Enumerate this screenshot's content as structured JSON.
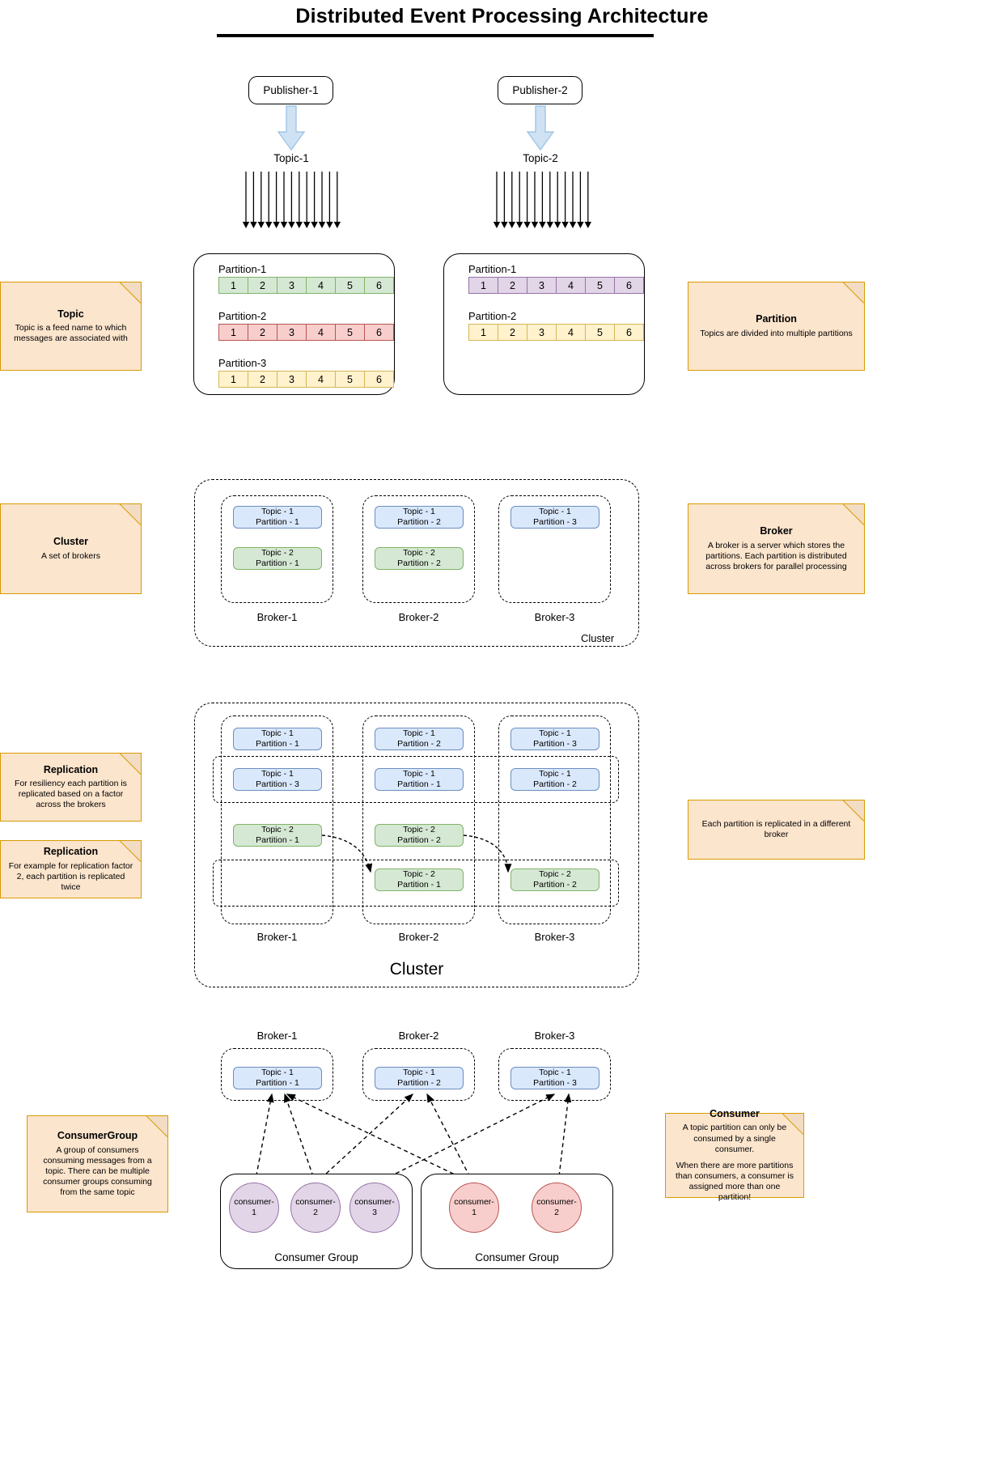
{
  "title": "Distributed Event Processing Architecture",
  "publishers": [
    {
      "label": "Publisher-1",
      "topic_label": "Topic-1"
    },
    {
      "label": "Publisher-2",
      "topic_label": "Topic-2"
    }
  ],
  "topics": [
    {
      "name": "Topic-1",
      "partitions": [
        {
          "label": "Partition-1",
          "color": "green",
          "cells": [
            "1",
            "2",
            "3",
            "4",
            "5",
            "6"
          ]
        },
        {
          "label": "Partition-2",
          "color": "red",
          "cells": [
            "1",
            "2",
            "3",
            "4",
            "5",
            "6"
          ]
        },
        {
          "label": "Partition-3",
          "color": "yellow",
          "cells": [
            "1",
            "2",
            "3",
            "4",
            "5",
            "6"
          ]
        }
      ]
    },
    {
      "name": "Topic-2",
      "partitions": [
        {
          "label": "Partition-1",
          "color": "purple",
          "cells": [
            "1",
            "2",
            "3",
            "4",
            "5",
            "6"
          ]
        },
        {
          "label": "Partition-2",
          "color": "yellow",
          "cells": [
            "1",
            "2",
            "3",
            "4",
            "5",
            "6"
          ]
        }
      ]
    }
  ],
  "notes": {
    "topic": {
      "title": "Topic",
      "body": "Topic is a feed name to which messages are associated with"
    },
    "partition": {
      "title": "Partition",
      "body": "Topics are divided into multiple partitions"
    },
    "cluster": {
      "title": "Cluster",
      "body": "A set of brokers"
    },
    "broker": {
      "title": "Broker",
      "body": "A broker is a server which stores the partitions. Each partition is distributed across brokers for parallel processing"
    },
    "replication1": {
      "title": "Replication",
      "body": "For resiliency each partition is replicated based on a factor across the brokers"
    },
    "replication2": {
      "title": "Replication",
      "body": "For example for replication factor 2, each partition is replicated twice"
    },
    "replication3": {
      "title": "",
      "body": "Each partition is replicated in a different broker"
    },
    "consumergroup": {
      "title": "ConsumerGroup",
      "body": "A group of consumers consuming messages from a topic. There can be multiple consumer groups consuming from the same topic"
    },
    "consumer": {
      "title": "Consumer",
      "body": "A topic partition can only be consumed by a single consumer.",
      "body2": "When there are more partitions than consumers, a consumer is assigned more than one partition!"
    }
  },
  "cluster_section": {
    "cluster_label": "Cluster",
    "brokers": [
      {
        "label": "Broker-1",
        "partitions": [
          {
            "line1": "Topic - 1",
            "line2": "Partition - 1",
            "color": "blue"
          },
          {
            "line1": "Topic - 2",
            "line2": "Partition - 1",
            "color": "green"
          }
        ]
      },
      {
        "label": "Broker-2",
        "partitions": [
          {
            "line1": "Topic - 1",
            "line2": "Partition - 2",
            "color": "blue"
          },
          {
            "line1": "Topic - 2",
            "line2": "Partition - 2",
            "color": "green"
          }
        ]
      },
      {
        "label": "Broker-3",
        "partitions": [
          {
            "line1": "Topic - 1",
            "line2": "Partition - 3",
            "color": "blue"
          }
        ]
      }
    ]
  },
  "replication_section": {
    "cluster_label": "Cluster",
    "broker_labels": [
      "Broker-1",
      "Broker-2",
      "Broker-3"
    ],
    "rows": [
      [
        {
          "line1": "Topic - 1",
          "line2": "Partition - 1",
          "color": "blue"
        },
        {
          "line1": "Topic - 1",
          "line2": "Partition - 2",
          "color": "blue"
        },
        {
          "line1": "Topic - 1",
          "line2": "Partition - 3",
          "color": "blue"
        }
      ],
      [
        {
          "line1": "Topic - 1",
          "line2": "Partition - 3",
          "color": "blue"
        },
        {
          "line1": "Topic - 1",
          "line2": "Partition - 1",
          "color": "blue"
        },
        {
          "line1": "Topic - 1",
          "line2": "Partition - 2",
          "color": "blue"
        }
      ],
      [
        {
          "line1": "Topic - 2",
          "line2": "Partition - 1",
          "color": "green"
        },
        {
          "line1": "Topic - 2",
          "line2": "Partition - 2",
          "color": "green"
        },
        null
      ],
      [
        null,
        {
          "line1": "Topic - 2",
          "line2": "Partition - 1",
          "color": "green"
        },
        {
          "line1": "Topic - 2",
          "line2": "Partition - 2",
          "color": "green"
        }
      ]
    ]
  },
  "consumer_section": {
    "broker_labels": [
      "Broker-1",
      "Broker-2",
      "Broker-3"
    ],
    "broker_partitions": [
      {
        "line1": "Topic - 1",
        "line2": "Partition - 1",
        "color": "blue"
      },
      {
        "line1": "Topic - 1",
        "line2": "Partition - 2",
        "color": "blue"
      },
      {
        "line1": "Topic - 1",
        "line2": "Partition - 3",
        "color": "blue"
      }
    ],
    "groups": [
      {
        "label": "Consumer Group",
        "color": "purple",
        "consumers": [
          {
            "line1": "consumer-",
            "line2": "1"
          },
          {
            "line1": "consumer-",
            "line2": "2"
          },
          {
            "line1": "consumer-",
            "line2": "3"
          }
        ]
      },
      {
        "label": "Consumer Group",
        "color": "red",
        "consumers": [
          {
            "line1": "consumer-",
            "line2": "1"
          },
          {
            "line1": "consumer-",
            "line2": "2"
          }
        ]
      }
    ]
  }
}
